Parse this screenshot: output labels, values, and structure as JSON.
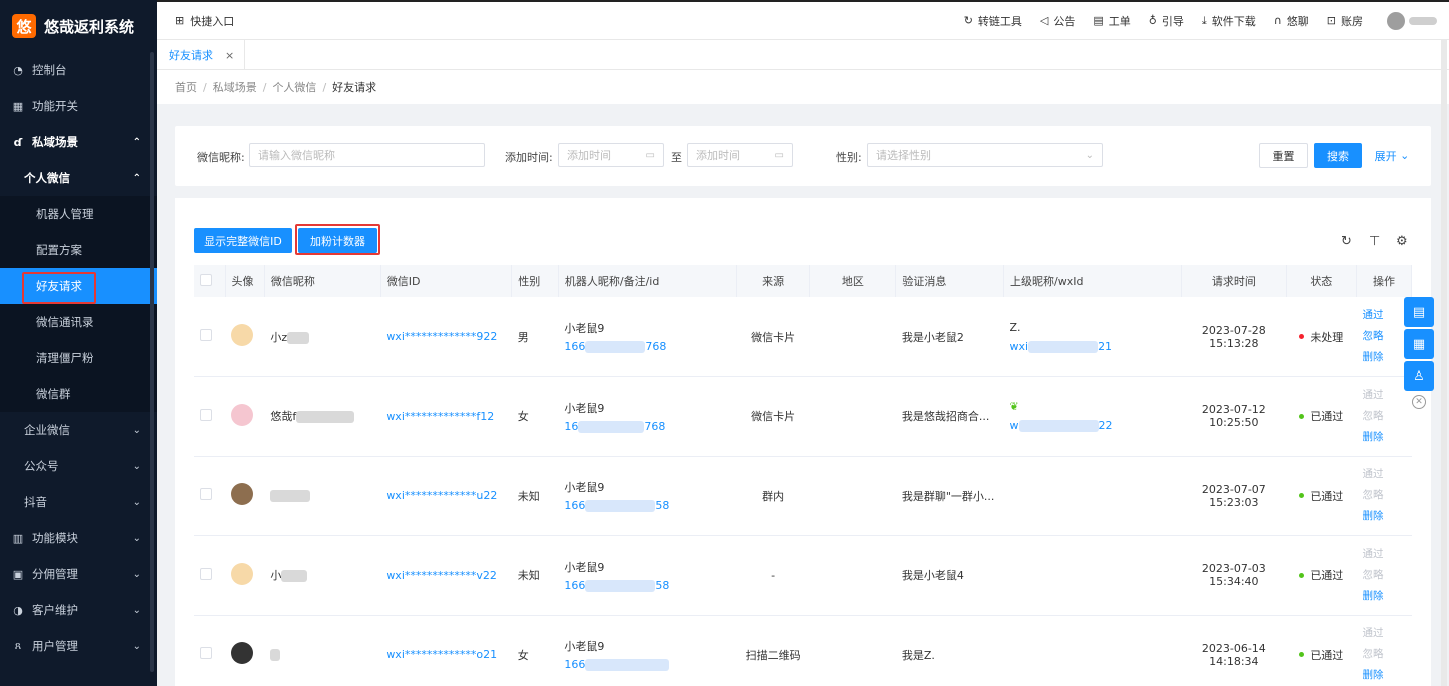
{
  "brand": {
    "logo": "悠",
    "name": "悠哉返利系统"
  },
  "sidebar": {
    "items": [
      {
        "label": "控制台",
        "icon": "dashboard-icon"
      },
      {
        "label": "功能开关",
        "icon": "switch-icon"
      },
      {
        "label": "私域场景",
        "icon": "scene-icon"
      },
      {
        "label": "个人微信"
      },
      {
        "label": "机器人管理"
      },
      {
        "label": "配置方案"
      },
      {
        "label": "好友请求"
      },
      {
        "label": "微信通讯录"
      },
      {
        "label": "清理僵尸粉"
      },
      {
        "label": "微信群"
      },
      {
        "label": "企业微信"
      },
      {
        "label": "公众号"
      },
      {
        "label": "抖音"
      },
      {
        "label": "功能模块",
        "icon": "module-icon"
      },
      {
        "label": "分佣管理",
        "icon": "commission-icon"
      },
      {
        "label": "客户维护",
        "icon": "customer-icon"
      },
      {
        "label": "用户管理",
        "icon": "user-icon"
      }
    ]
  },
  "topbar": {
    "quick": "快捷入口",
    "links": [
      "转链工具",
      "公告",
      "工单",
      "引导",
      "软件下载",
      "悠聊",
      "账房"
    ]
  },
  "tab": {
    "label": "好友请求",
    "close": "×"
  },
  "breadcrumb": [
    "首页",
    "私域场景",
    "个人微信",
    "好友请求"
  ],
  "search": {
    "nickname_label": "微信昵称:",
    "nickname_placeholder": "请输入微信昵称",
    "time_label": "添加时间:",
    "time_start_placeholder": "添加时间",
    "to": "至",
    "time_end_placeholder": "添加时间",
    "gender_label": "性别:",
    "gender_placeholder": "请选择性别",
    "reset": "重置",
    "search": "搜索",
    "expand": "展开"
  },
  "toolbar": {
    "show_full_id": "显示完整微信ID",
    "counter": "加粉计数器"
  },
  "table": {
    "headers": [
      "头像",
      "微信昵称",
      "微信ID",
      "性别",
      "机器人昵称/备注/id",
      "来源",
      "地区",
      "验证消息",
      "上级昵称/wxId",
      "请求时间",
      "状态",
      "操作"
    ],
    "ops": {
      "pass": "通过",
      "ignore": "忽略",
      "delete": "删除"
    },
    "rows": [
      {
        "nickname": "小z",
        "wxid": "wxi*************922",
        "gender": "男",
        "robot": "小老鼠9",
        "robot_id": "166",
        "robot_tail": "768",
        "source": "微信卡片",
        "region": "",
        "message": "我是小老鼠2",
        "parent": "Z.",
        "parent_id": "wxi",
        "parent_tail": "21",
        "time": "2023-07-28 15:13:28",
        "status": "未处理",
        "status_color": "#f5222d"
      },
      {
        "nickname": "悠哉f",
        "wxid": "wxi*************f12",
        "gender": "女",
        "robot": "小老鼠9",
        "robot_id": "16",
        "robot_tail": "768",
        "source": "微信卡片",
        "region": "",
        "message": "我是悠哉招商合...",
        "parent": "",
        "parent_id": "w",
        "parent_tail": "22",
        "time": "2023-07-12 10:25:50",
        "status": "已通过",
        "status_color": "#52c41a"
      },
      {
        "nickname": "",
        "wxid": "wxi*************u22",
        "gender": "未知",
        "robot": "小老鼠9",
        "robot_id": "166",
        "robot_tail": "58",
        "source": "群内",
        "region": "",
        "message": "我是群聊\"一群小...",
        "parent": "",
        "parent_id": "",
        "parent_tail": "",
        "time": "2023-07-07 15:23:03",
        "status": "已通过",
        "status_color": "#52c41a"
      },
      {
        "nickname": "小",
        "wxid": "wxi*************v22",
        "gender": "未知",
        "robot": "小老鼠9",
        "robot_id": "166",
        "robot_tail": "58",
        "source": "-",
        "region": "",
        "message": "我是小老鼠4",
        "parent": "",
        "parent_id": "",
        "parent_tail": "",
        "time": "2023-07-03 15:34:40",
        "status": "已通过",
        "status_color": "#52c41a"
      },
      {
        "nickname": "",
        "wxid": "wxi*************o21",
        "gender": "女",
        "robot": "小老鼠9",
        "robot_id": "166",
        "robot_tail": "",
        "source": "扫描二维码",
        "region": "",
        "message": "我是Z.",
        "parent": "",
        "parent_id": "",
        "parent_tail": "",
        "time": "2023-06-14 14:18:34",
        "status": "已通过",
        "status_color": "#52c41a"
      }
    ]
  }
}
